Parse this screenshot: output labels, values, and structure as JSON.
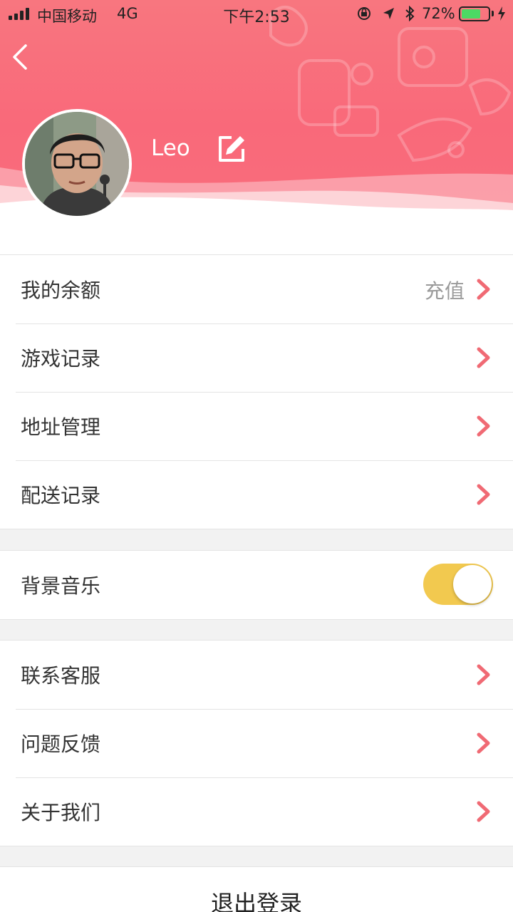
{
  "status_bar": {
    "carrier": "中国移动",
    "network": "4G",
    "time": "下午2:53",
    "battery_percent": "72%",
    "battery_level": 0.72
  },
  "profile": {
    "username": "Leo"
  },
  "menu_group_1": [
    {
      "label": "我的余额",
      "value": "充值"
    },
    {
      "label": "游戏记录"
    },
    {
      "label": "地址管理"
    },
    {
      "label": "配送记录"
    }
  ],
  "settings": {
    "background_music_label": "背景音乐",
    "background_music_on": true
  },
  "menu_group_2": [
    {
      "label": "联系客服"
    },
    {
      "label": "问题反馈"
    },
    {
      "label": "关于我们"
    }
  ],
  "logout_label": "退出登录",
  "colors": {
    "header": "#f96d7c",
    "chevron": "#f06a74",
    "toggle_on": "#f2c94f"
  },
  "icons": [
    "back-icon",
    "edit-icon",
    "chevron-right-icon",
    "avatar-photo"
  ]
}
